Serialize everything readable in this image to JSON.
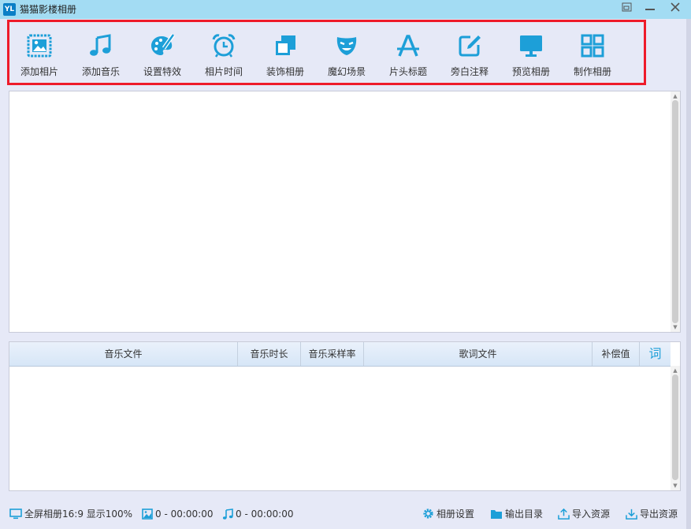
{
  "window": {
    "logo": "YL",
    "title": "猫猫影楼相册",
    "controls": [
      "restore-icon",
      "minimize-icon",
      "close-icon"
    ]
  },
  "colors": {
    "accent": "#1d9fd8",
    "highlight_frame": "#ee1b2a",
    "titlebar": "#a3dcf3"
  },
  "toolbar": {
    "items": [
      {
        "label": "添加相片",
        "icon": "add-photo-icon"
      },
      {
        "label": "添加音乐",
        "icon": "music-note-icon"
      },
      {
        "label": "设置特效",
        "icon": "palette-icon"
      },
      {
        "label": "相片时间",
        "icon": "alarm-clock-icon"
      },
      {
        "label": "装饰相册",
        "icon": "layers-icon"
      },
      {
        "label": "魔幻场景",
        "icon": "theater-mask-icon"
      },
      {
        "label": "片头标题",
        "icon": "title-a-icon"
      },
      {
        "label": "旁白注释",
        "icon": "edit-note-icon"
      },
      {
        "label": "预览相册",
        "icon": "monitor-icon"
      },
      {
        "label": "制作相册",
        "icon": "grid-icon"
      }
    ]
  },
  "music_table": {
    "columns": [
      "音乐文件",
      "音乐时长",
      "音乐采样率",
      "歌词文件",
      "补偿值",
      "词"
    ],
    "rows": []
  },
  "statusbar": {
    "album_info": "全屏相册16:9 显示100%",
    "photo_count": "0 - 00:00:00",
    "music_count": "0 - 00:00:00",
    "album_settings": "相册设置",
    "output_dir": "输出目录",
    "import_resources": "导入资源",
    "export_resources": "导出资源"
  }
}
